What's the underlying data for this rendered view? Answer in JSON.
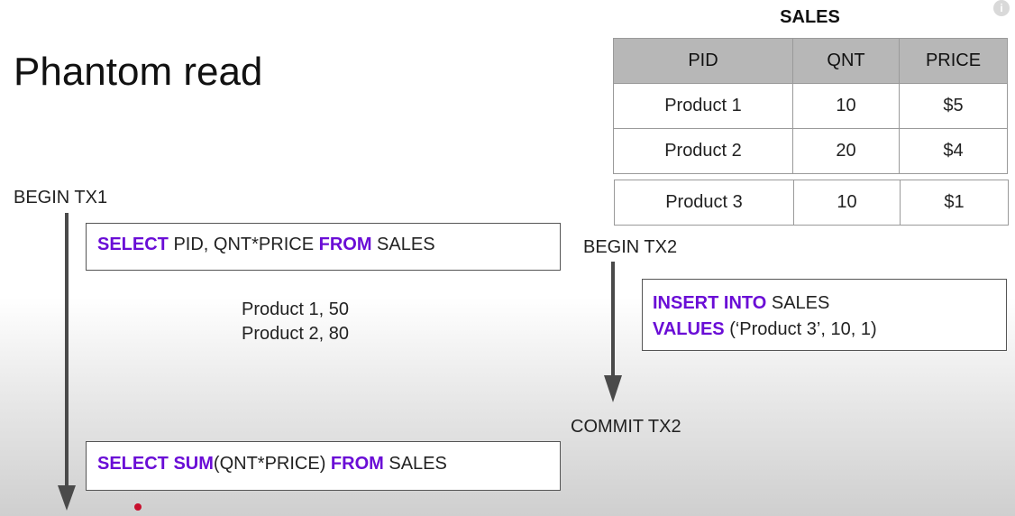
{
  "title": "Phantom read",
  "table": {
    "caption": "SALES",
    "headers": [
      "PID",
      "QNT",
      "PRICE"
    ],
    "rows": [
      [
        "Product 1",
        "10",
        "$5"
      ],
      [
        "Product 2",
        "20",
        "$4"
      ]
    ],
    "added_row": [
      "Product 3",
      "10",
      "$1"
    ]
  },
  "tx1": {
    "begin_label": "BEGIN TX1",
    "query1": {
      "kw1": "SELECT",
      "text1": " PID, QNT*PRICE ",
      "kw2": "FROM",
      "text2": " SALES"
    },
    "results": [
      "Product 1, 50",
      "Product 2, 80"
    ],
    "query2": {
      "kw1": "SELECT SUM",
      "text1": "(QNT*PRICE) ",
      "kw2": "FROM",
      "text2": " SALES"
    }
  },
  "tx2": {
    "begin_label": "BEGIN TX2",
    "insert_line1": {
      "kw": "INSERT INTO",
      "text": " SALES"
    },
    "insert_line2": {
      "kw": "VALUES",
      "text": " (‘Product 3’, 10, 1)"
    },
    "commit_label": "COMMIT TX2"
  },
  "colors": {
    "keyword": "#6a0dd6",
    "header_bg": "#b7b7b7",
    "marker": "#c8102e"
  },
  "info_icon": "i"
}
